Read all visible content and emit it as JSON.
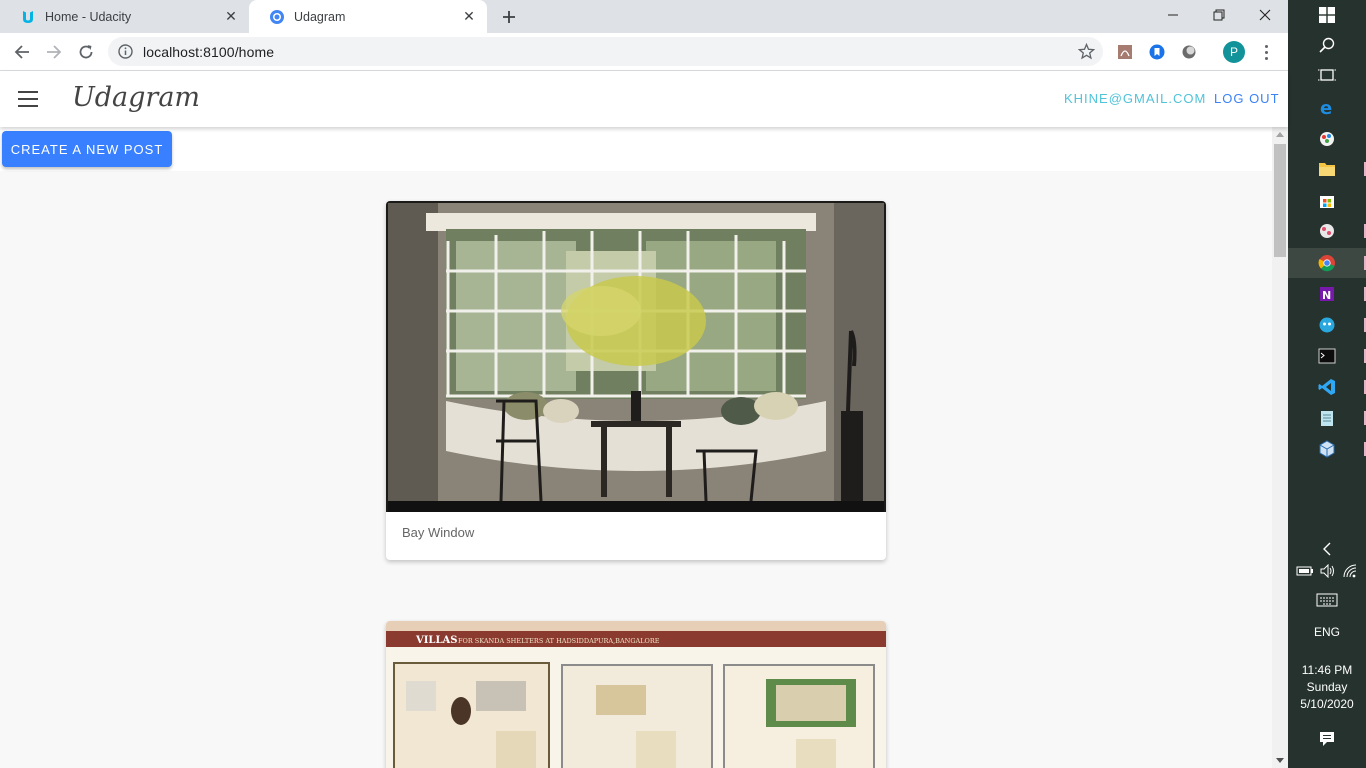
{
  "browser": {
    "tabs": [
      {
        "title": "Home - Udacity",
        "icon": "udacity-logo-icon"
      },
      {
        "title": "Udagram",
        "icon": "globe-icon",
        "active": true
      }
    ],
    "url": "localhost:8100/home",
    "profile_initial": "P"
  },
  "app": {
    "brand": "Udagram",
    "user_email": "KHINE@GMAIL.COM",
    "logout_label": "LOG OUT",
    "create_post_label": "CREATE A NEW POST",
    "accent_color": "#3880ff"
  },
  "feed": [
    {
      "caption": "Bay Window",
      "image": "bay-window-photo"
    },
    {
      "caption": "",
      "image": "villa-floor-plans",
      "header_text": "VILLAS",
      "header_detail": "FOR SKANDA SHELTERS AT HADSIDDAPURA,BANGALORE"
    }
  ],
  "taskbar": {
    "language": "ENG",
    "time": "11:46 PM",
    "day": "Sunday",
    "date": "5/10/2020"
  }
}
